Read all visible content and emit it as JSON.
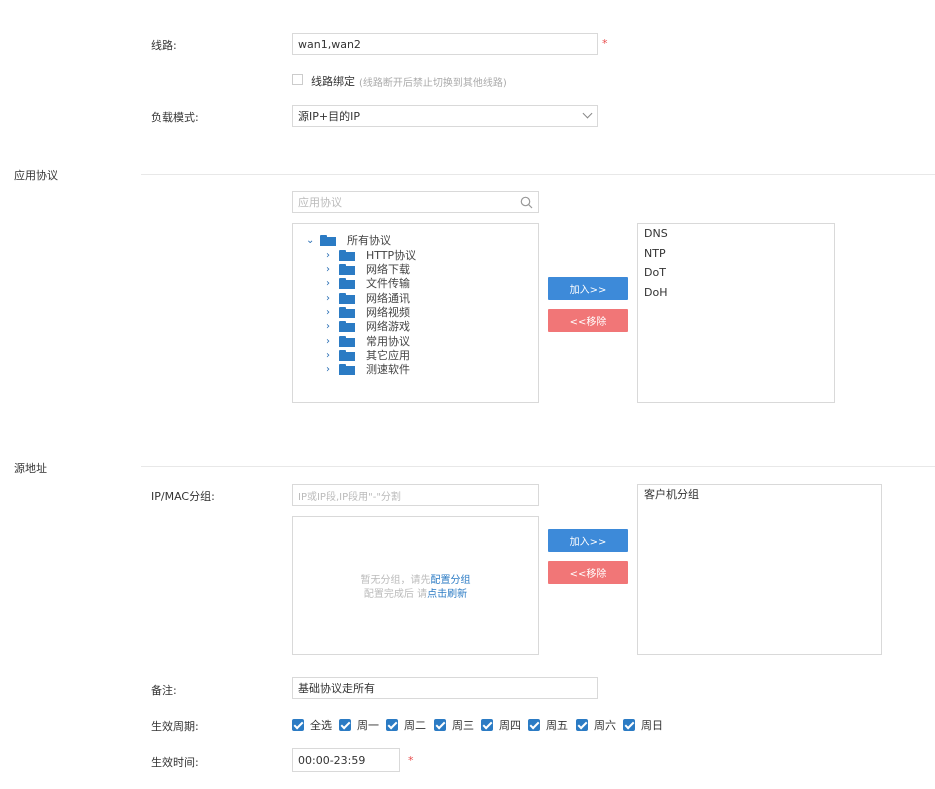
{
  "line": {
    "label": "线路:",
    "value": "wan1,wan2",
    "required": "*"
  },
  "bind": {
    "label": "线路绑定",
    "hint": "(线路断开后禁止切换到其他线路)"
  },
  "load_mode": {
    "label": "负载模式:",
    "value": "源IP+目的IP"
  },
  "app_protocol": {
    "section_title": "应用协议",
    "search_placeholder": "应用协议",
    "tree": {
      "root": "所有协议",
      "children": [
        "HTTP协议",
        "网络下载",
        "文件传输",
        "网络通讯",
        "网络视频",
        "网络游戏",
        "常用协议",
        "其它应用",
        "测速软件"
      ]
    },
    "add_button": "加入>>",
    "remove_button": "<<移除",
    "selected": [
      "DNS",
      "NTP",
      "DoT",
      "DoH"
    ]
  },
  "source": {
    "section_title": "源地址",
    "ipmac_label": "IP/MAC分组:",
    "ipmac_placeholder": "IP或IP段,IP段用\"-\"分割",
    "empty_text1": "暂无分组，请先",
    "empty_link1": "配置分组",
    "empty_text2": "配置完成后 请",
    "empty_link2": "点击刷新",
    "add_button": "加入>>",
    "remove_button": "<<移除",
    "selected": [
      "客户机分组"
    ]
  },
  "remark": {
    "label": "备注:",
    "value": "基础协议走所有"
  },
  "period": {
    "label": "生效周期:",
    "options": [
      "全选",
      "周一",
      "周二",
      "周三",
      "周四",
      "周五",
      "周六",
      "周日"
    ]
  },
  "time": {
    "label": "生效时间:",
    "value": "00:00-23:59",
    "required": "*"
  }
}
